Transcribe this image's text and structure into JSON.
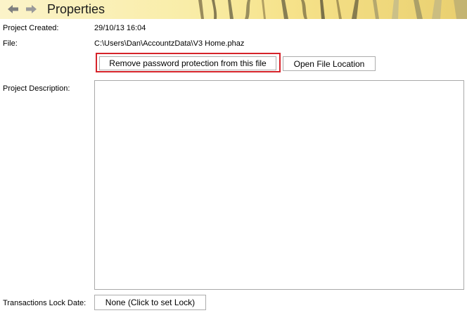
{
  "header": {
    "title": "Properties",
    "back_icon": "arrow-left-icon",
    "forward_icon": "arrow-right-icon"
  },
  "fields": {
    "created_label": "Project Created:",
    "created_value": "29/10/13 16:04",
    "file_label": "File:",
    "file_value": "C:\\Users\\Dan\\AccountzData\\V3 Home.phaz",
    "description_label": "Project Description:",
    "description_value": "",
    "lock_label": "Transactions Lock Date:"
  },
  "buttons": {
    "remove_password": "Remove password protection from this file",
    "open_location": "Open File Location",
    "lock_date": "None (Click to set Lock)"
  },
  "colors": {
    "highlight": "#d6232a",
    "header_background": "#f6e28a"
  }
}
